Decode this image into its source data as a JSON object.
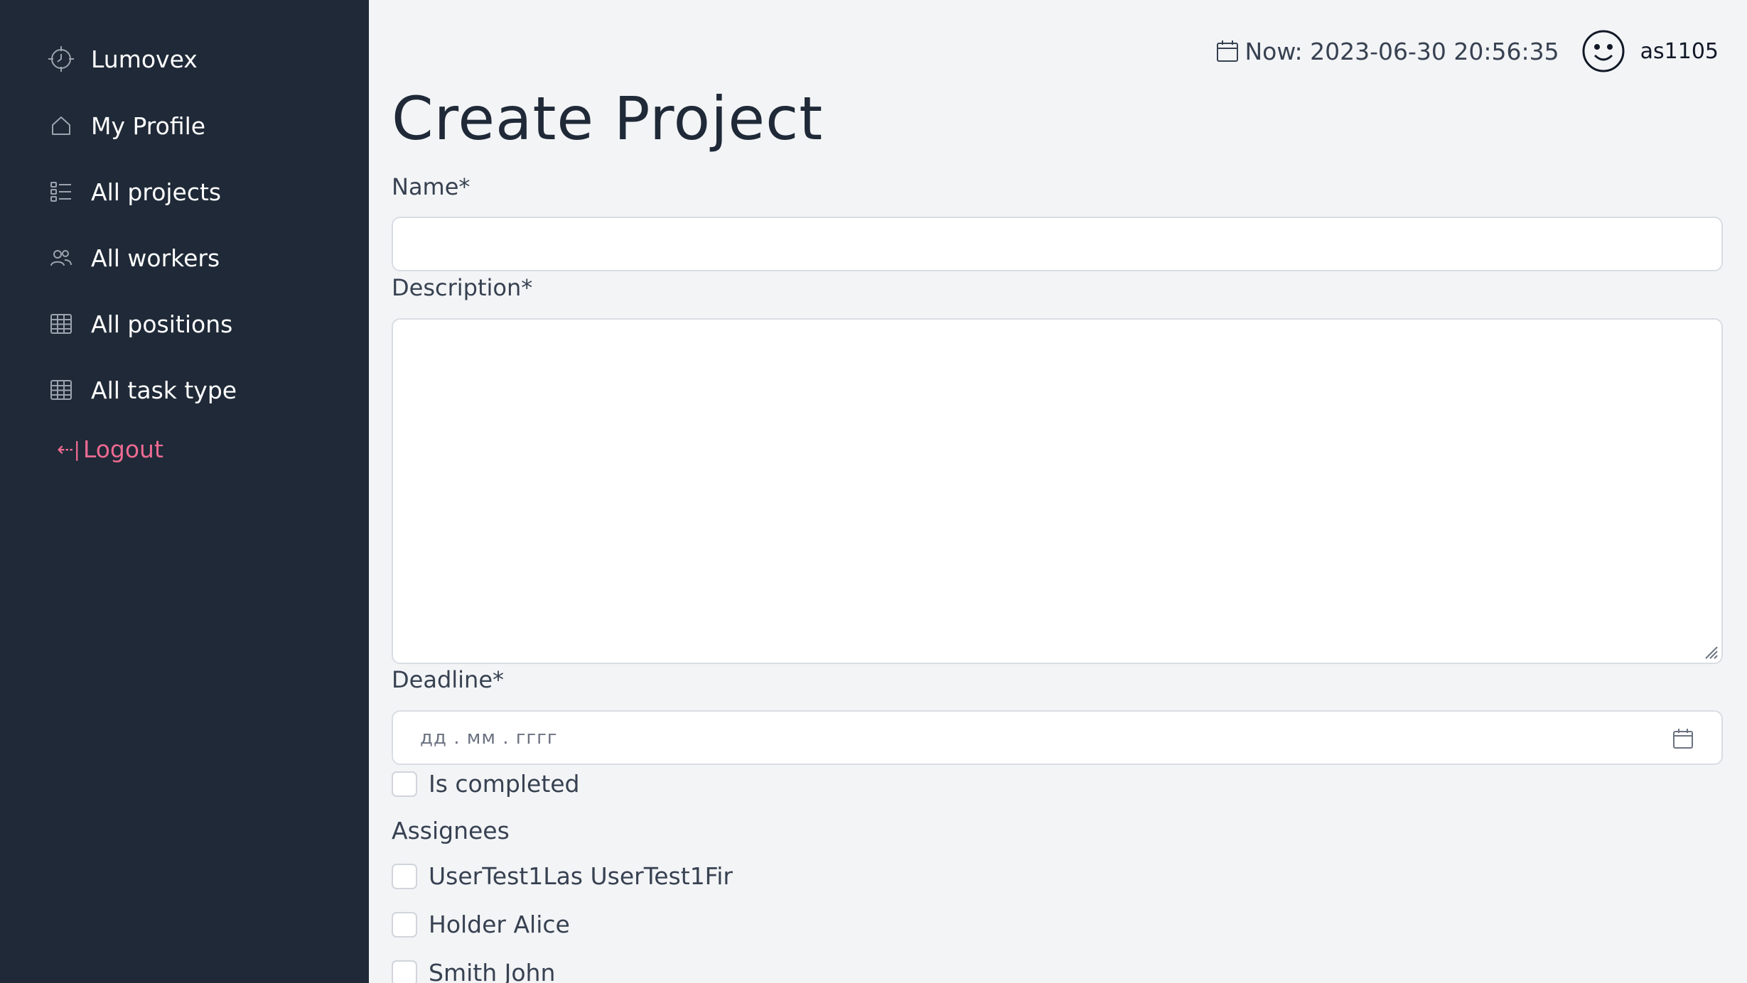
{
  "sidebar": {
    "brand": "Lumovex",
    "items": [
      {
        "label": "My Profile",
        "icon": "home-icon"
      },
      {
        "label": "All projects",
        "icon": "checklist-icon"
      },
      {
        "label": "All workers",
        "icon": "users-icon"
      },
      {
        "label": "All positions",
        "icon": "table-icon"
      },
      {
        "label": "All task type",
        "icon": "table-icon"
      }
    ],
    "logout": "Logout"
  },
  "header": {
    "now": "Now: 2023-06-30 20:56:35",
    "username": "as1105"
  },
  "form": {
    "title": "Create Project",
    "name_label": "Name*",
    "name_value": "",
    "description_label": "Description*",
    "description_value": "",
    "deadline_label": "Deadline*",
    "deadline_placeholder": "дд . мм . гггг",
    "is_completed_label": "Is completed",
    "assignees_label": "Assignees",
    "assignees": [
      {
        "name": "UserTest1Las UserTest1Fir",
        "checked": false
      },
      {
        "name": "Holder Alice",
        "checked": false
      },
      {
        "name": "Smith John",
        "checked": false
      }
    ]
  },
  "colors": {
    "sidebar_bg": "#1f2937",
    "page_bg": "#f3f4f6",
    "logout": "#ec6a91"
  }
}
